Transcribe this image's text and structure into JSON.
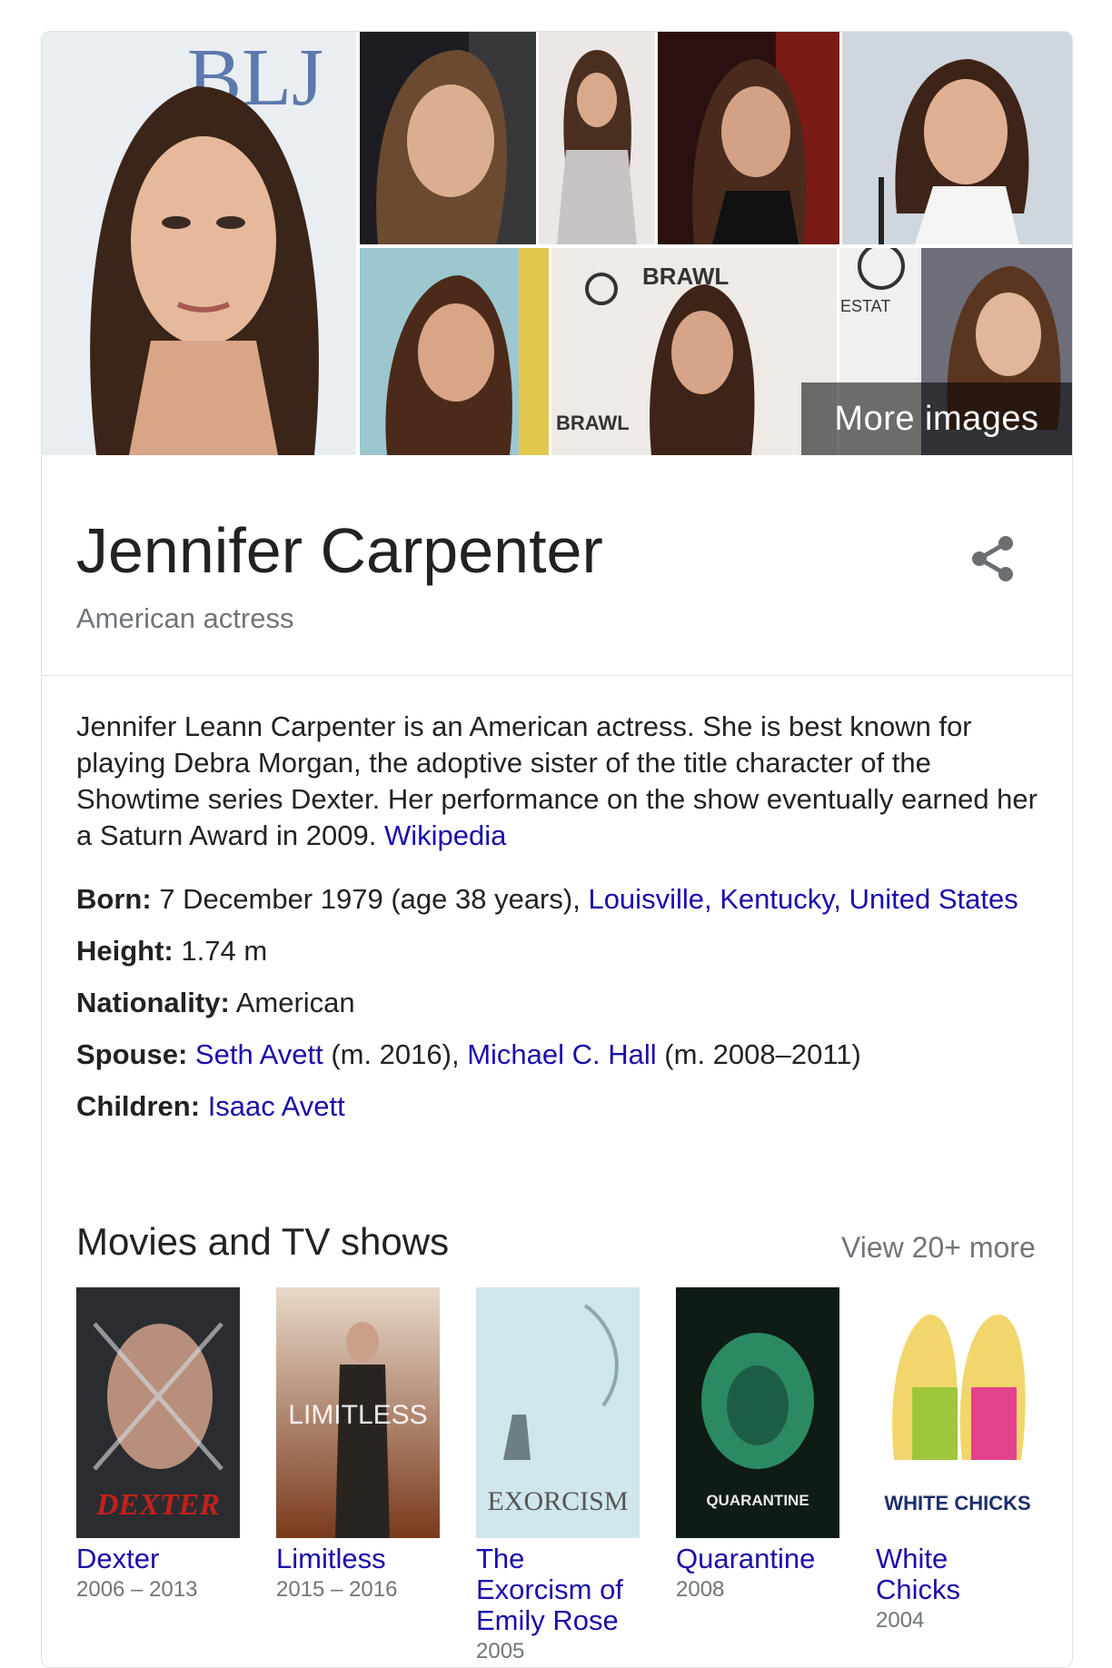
{
  "images": {
    "more_images_label": "More images"
  },
  "entity": {
    "name": "Jennifer Carpenter",
    "subtitle": "American actress"
  },
  "description": {
    "text": "Jennifer Leann Carpenter is an American actress. She is best known for playing Debra Morgan, the adoptive sister of the title character of the Showtime series Dexter. Her performance on the show eventually earned her a Saturn Award in 2009.",
    "source_link": "Wikipedia"
  },
  "facts": {
    "born": {
      "label": "Born:",
      "value": "7 December 1979 (age 38 years),",
      "place_link": "Louisville, Kentucky, United States"
    },
    "height": {
      "label": "Height:",
      "value": "1.74 m"
    },
    "nationality": {
      "label": "Nationality:",
      "value": "American"
    },
    "spouse": {
      "label": "Spouse:",
      "spouse1": "Seth Avett",
      "spouse1_note": "(m. 2016),",
      "spouse2": "Michael C. Hall",
      "spouse2_note": "(m. 2008–2011)"
    },
    "children": {
      "label": "Children:",
      "child1": "Isaac Avett"
    }
  },
  "movies": {
    "section_title": "Movies and TV shows",
    "view_more": "View 20+ more",
    "items": [
      {
        "title": "Dexter",
        "years": "2006 – 2013",
        "poster_text": "DEXTER"
      },
      {
        "title": "Limitless",
        "years": "2015 – 2016",
        "poster_text": "LIMITLESS"
      },
      {
        "title": "The Exorcism of Emily Rose",
        "years": "2005",
        "poster_text": "EXORCISM"
      },
      {
        "title": "Quarantine",
        "years": "2008",
        "poster_text": "QUARANTINE"
      },
      {
        "title": "White Chicks",
        "years": "2004",
        "poster_text": "WHITE CHICKS"
      }
    ]
  },
  "colors": {
    "link": "#1a0dab",
    "secondary_text": "#70757a",
    "border": "#dfe1e5"
  },
  "icons": {
    "share": "share-icon"
  }
}
